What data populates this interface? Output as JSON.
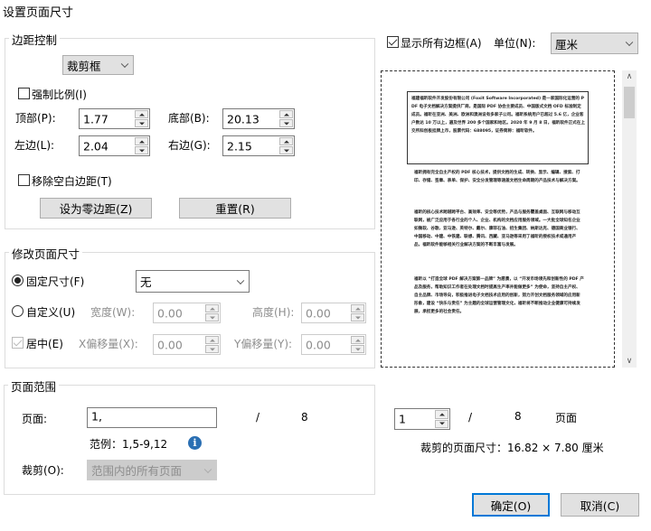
{
  "window": {
    "title": "设置页面尺寸"
  },
  "margins": {
    "legend": "边距控制",
    "box_select": "裁剪框",
    "force_ratio": "强制比例(I)",
    "top_label": "顶部(P):",
    "top": "1.77",
    "bottom_label": "底部(B):",
    "bottom": "20.13",
    "left_label": "左边(L):",
    "left": "2.04",
    "right_label": "右边(G):",
    "right": "2.15",
    "remove_white": "移除空白边距(T)",
    "zero_btn": "设为零边距(Z)",
    "reset_btn": "重置(R)"
  },
  "resize": {
    "legend": "修改页面尺寸",
    "fixed": "固定尺寸(F)",
    "fixed_select": "无",
    "custom": "自定义(U)",
    "width_label": "宽度(W):",
    "width": "0.00",
    "height_label": "高度(H):",
    "height": "0.00",
    "center": "居中(E)",
    "xoff_label": "X偏移量(X):",
    "xoff": "0.00",
    "yoff_label": "Y偏移量(Y):",
    "yoff": "0.00"
  },
  "range": {
    "legend": "页面范围",
    "pages_label": "页面:",
    "pages_value": "1,",
    "slash": "/",
    "total": "8",
    "example": "范例：1,5-9,12",
    "info_icon": "info-icon",
    "crop_label": "裁剪(O):",
    "crop_select": "范围内的所有页面"
  },
  "display": {
    "show_all_boxes": "显示所有边框(A)",
    "unit_label": "单位(N):",
    "unit": "厘米"
  },
  "preview": {
    "box_text": "福建福昕软件开发股份有限公司 (Foxit Software Incorporated) 是一家国际化运营的 PDF 电子文档解决方案提供厂商，是国际 PDF 协会主要成员、中国版式文档 OFD 标准制定成员。福昕在亚洲、美洲、欧洲和澳洲设有多家子公司。福昕系统用户已超过 5.6 亿，企业客户数达 10 万以上，遍及世界 200 多个国家和地区。2020 年 9 月 8 日，福昕软件正式在上交所科创板挂牌上市，股票代码：688095，证券简称：福昕软件。",
    "paragraphs": [
      "福昕拥有完全自主产权的 PDF 核心技术，提供文档的生成、转换、显示、编辑、搜索、打印、存储、签章、表单、保护、安全分发管理等涵盖文档生命周期的产品技术与解决方案。",
      "福昕的核心技术跨越跨平台、高效率、安全等优势，产品与服务覆盖桌面、互联网与移动互联网，被广泛应用于各行业的个人、企业、机构的文档应用服务领域。一大批全球知名企业如微软、谷歌、亚马逊、英特尔、戴尔、康菲石油、招生集团、纳斯达克、德国商业银行、中国移动、中建、中铁建、联想、腾讯、西藏、亚马逊等采用了福昕的授权技术或通用产品，福昕软件能够相关行业解决方案的不断丰富与发展。",
      "福昕以 “打造全球 PDF 解决方案第一品牌” 为愿景，以 “开发市场领先和创新性的 PDF 产品及服务，帮助知识工作者在处理文档时提高生产率并能做更多” 为使命，坚持自主产权、自主品牌、市场导向，积极推进电子文档技术应用的创新，努力开创文档服务领域的应用新形象，建设 “快乐与责任” 为主题的全球运营管理文化，福昕将不断推动企业健康可持续发展，承担更多的社会责任。"
    ]
  },
  "page_nav": {
    "current": "1",
    "slash": "/",
    "total": "8",
    "unit": "页面",
    "crop_size": "裁剪的页面尺寸：16.82 × 7.80  厘米"
  },
  "footer": {
    "ok": "确定(O)",
    "cancel": "取消(C)"
  },
  "colors": {
    "primary_border": "#0078d7",
    "info": "#2a6fb3"
  }
}
